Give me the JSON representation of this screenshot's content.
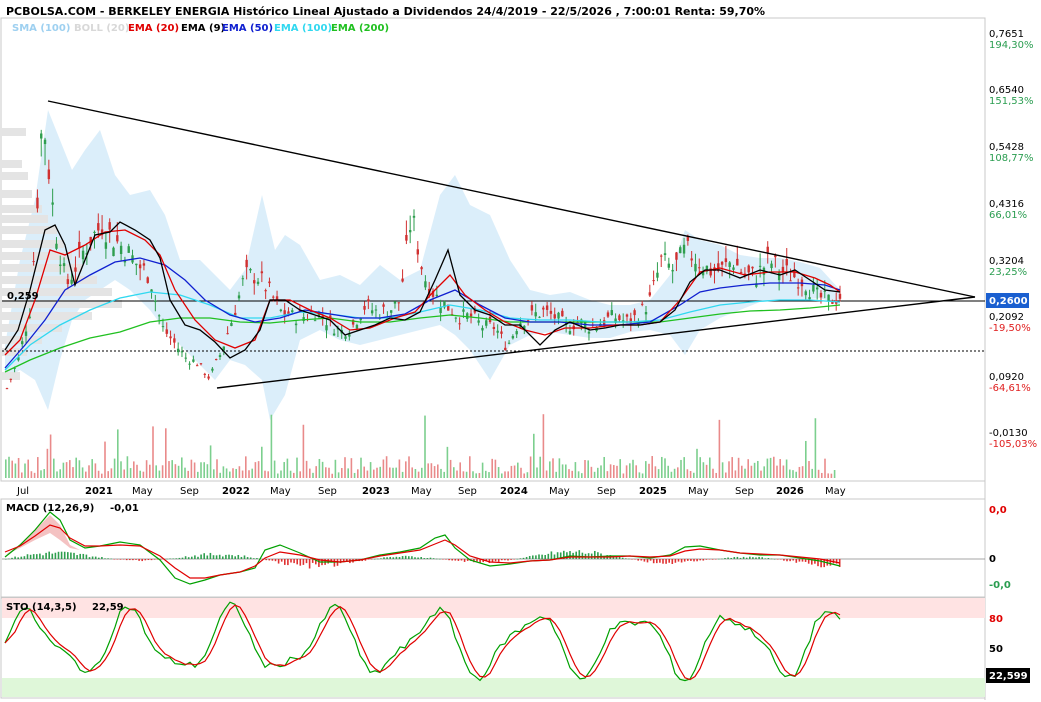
{
  "title": "PCBOLSA.COM - BERKELEY ENERGIA Histórico Lineal Ajustado a Dividendos 24/4/2019 - 22/5/2026 , 7:00:01 Renta: 59,70%",
  "legend": [
    {
      "label": "SMA (100)",
      "color": "#9ed0f0"
    },
    {
      "label": "BOLL (20)",
      "color": "#d8d8d8"
    },
    {
      "label": "EMA (20)",
      "color": "#e00000"
    },
    {
      "label": "EMA (9)",
      "color": "#000000"
    },
    {
      "label": "EMA (50)",
      "color": "#1020d0"
    },
    {
      "label": "EMA (100)",
      "color": "#30d8f0"
    },
    {
      "label": "EMA (200)",
      "color": "#20c020"
    }
  ],
  "price_axis": [
    {
      "value": "0,7651",
      "pct": "194,30%",
      "pct_color": "#2a9d50"
    },
    {
      "value": "0,6540",
      "pct": "151,53%",
      "pct_color": "#2a9d50"
    },
    {
      "value": "0,5428",
      "pct": "108,77%",
      "pct_color": "#2a9d50"
    },
    {
      "value": "0,4316",
      "pct": "66,01%",
      "pct_color": "#2a9d50"
    },
    {
      "value": "0,3204",
      "pct": "23,25%",
      "pct_color": "#2a9d50"
    },
    {
      "value": "0,2092",
      "pct": "-19,50%",
      "pct_color": "#e02020"
    },
    {
      "value": "0,0920",
      "pct": "-64,61%",
      "pct_color": "#e02020"
    },
    {
      "value": "-0,0130",
      "pct": "-105,03%",
      "pct_color": "#e02020"
    }
  ],
  "current_price_label": "0,2600",
  "reference_line_label": "0,259",
  "time_axis": [
    {
      "label": "Jul",
      "bold": false
    },
    {
      "label": "2021",
      "bold": true
    },
    {
      "label": "May",
      "bold": false
    },
    {
      "label": "Sep",
      "bold": false
    },
    {
      "label": "2022",
      "bold": true
    },
    {
      "label": "May",
      "bold": false
    },
    {
      "label": "Sep",
      "bold": false
    },
    {
      "label": "2023",
      "bold": true
    },
    {
      "label": "May",
      "bold": false
    },
    {
      "label": "Sep",
      "bold": false
    },
    {
      "label": "2024",
      "bold": true
    },
    {
      "label": "May",
      "bold": false
    },
    {
      "label": "Sep",
      "bold": false
    },
    {
      "label": "2025",
      "bold": true
    },
    {
      "label": "May",
      "bold": false
    },
    {
      "label": "Sep",
      "bold": false
    },
    {
      "label": "2026",
      "bold": true
    },
    {
      "label": "May",
      "bold": false
    }
  ],
  "macd": {
    "label": "MACD (12,26,9)",
    "value": "-0,01",
    "axis": [
      "0,0",
      "0",
      "-0,0"
    ]
  },
  "sto": {
    "label": "STO (14,3,5)",
    "value": "22,59",
    "axis": [
      "80",
      "50"
    ],
    "current_label": "22,599"
  },
  "chart_data": {
    "type": "line",
    "price_series": {
      "name": "BERKELEY ENERGIA",
      "x": [
        "2020-07",
        "2020-08",
        "2020-09",
        "2020-10",
        "2020-11",
        "2020-12",
        "2021-01",
        "2021-02",
        "2021-03",
        "2021-04",
        "2021-05",
        "2021-06",
        "2021-07",
        "2021-08",
        "2021-09",
        "2021-10",
        "2021-11",
        "2021-12",
        "2022-01",
        "2022-02",
        "2022-03",
        "2022-04",
        "2022-05",
        "2022-06",
        "2022-07",
        "2022-08",
        "2022-09",
        "2022-10",
        "2022-11",
        "2022-12",
        "2023-01",
        "2023-02",
        "2023-03",
        "2023-04",
        "2023-05",
        "2023-06",
        "2023-07",
        "2023-08",
        "2023-09",
        "2023-10",
        "2023-11",
        "2023-12",
        "2024-01",
        "2024-02",
        "2024-03",
        "2024-04",
        "2024-05",
        "2024-06",
        "2024-07",
        "2024-08",
        "2024-09",
        "2024-10",
        "2024-11",
        "2024-12",
        "2025-01",
        "2025-02",
        "2025-03",
        "2025-04",
        "2025-05",
        "2025-06",
        "2025-07",
        "2025-08",
        "2025-09",
        "2025-10",
        "2025-11",
        "2025-12",
        "2026-01",
        "2026-02",
        "2026-03",
        "2026-04",
        "2026-05"
      ],
      "y": [
        0.08,
        0.14,
        0.24,
        0.62,
        0.4,
        0.28,
        0.33,
        0.37,
        0.4,
        0.37,
        0.35,
        0.32,
        0.3,
        0.2,
        0.17,
        0.14,
        0.13,
        0.1,
        0.15,
        0.22,
        0.3,
        0.3,
        0.27,
        0.23,
        0.22,
        0.22,
        0.23,
        0.21,
        0.19,
        0.2,
        0.24,
        0.23,
        0.23,
        0.25,
        0.42,
        0.3,
        0.26,
        0.24,
        0.22,
        0.22,
        0.2,
        0.2,
        0.16,
        0.21,
        0.22,
        0.23,
        0.22,
        0.2,
        0.21,
        0.2,
        0.21,
        0.22,
        0.21,
        0.22,
        0.25,
        0.33,
        0.31,
        0.35,
        0.33,
        0.31,
        0.31,
        0.33,
        0.3,
        0.3,
        0.33,
        0.31,
        0.3,
        0.29,
        0.26,
        0.25,
        0.26
      ]
    },
    "ylim": [
      -0.05,
      0.8
    ],
    "reference_lines": [
      0.259,
      0.159
    ]
  }
}
